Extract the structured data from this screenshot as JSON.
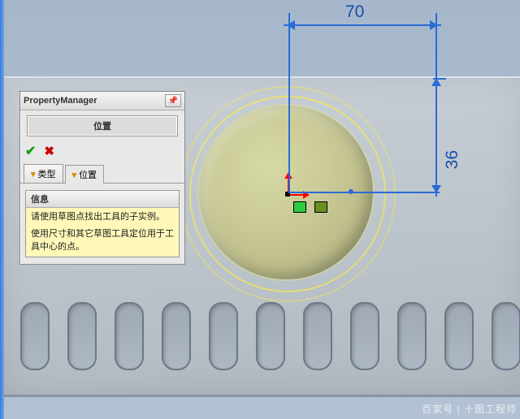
{
  "dimensions": {
    "horizontal": "70",
    "vertical": "36"
  },
  "panel": {
    "title": "PropertyManager",
    "subtitle": "位置",
    "tabs": {
      "type": "类型",
      "position": "位置"
    },
    "group": {
      "heading": "信息",
      "line1": "请使用草图点找出工具的子实例。",
      "line2": "使用尺寸和其它草图工具定位用于工具中心的点。"
    }
  },
  "watermark": "百家号 | 十图工程师"
}
